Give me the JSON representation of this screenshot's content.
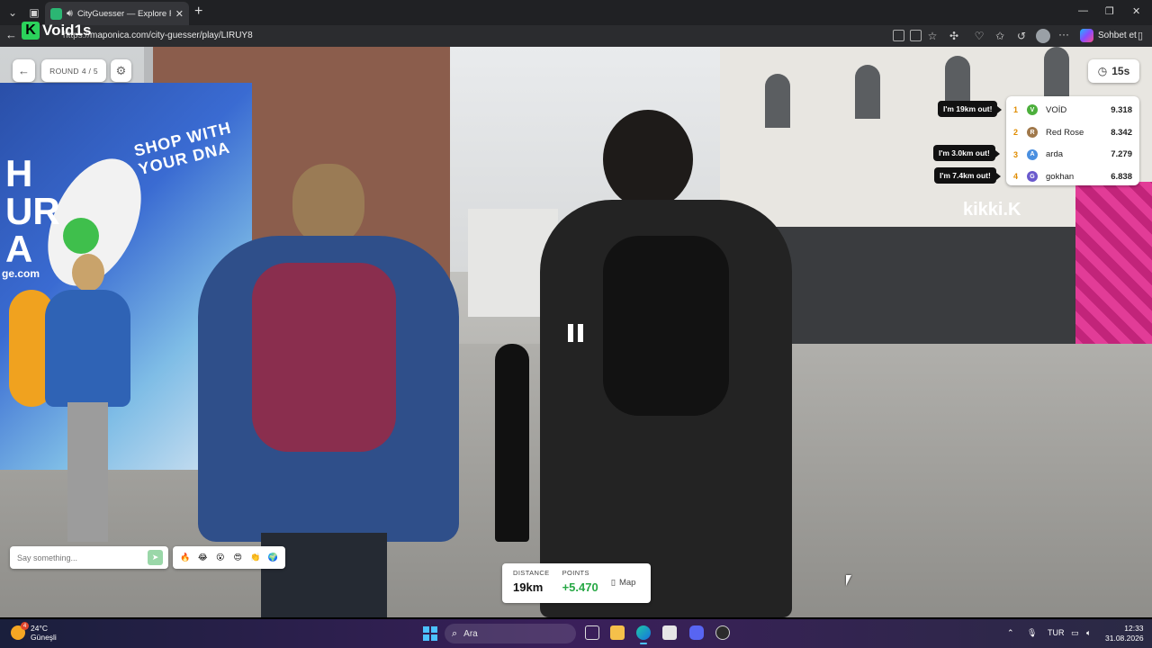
{
  "browser": {
    "tab_title": "CityGuesser — Explore Real C",
    "url_scheme": "https://",
    "url_rest": "maponica.com/city-guesser/play/LIRUY8",
    "profile_label": "Sohbet et"
  },
  "overlay_logo": {
    "letter": "K",
    "text": "Void1s"
  },
  "game": {
    "round_label": "ROUND",
    "round_value": "4 / 5",
    "timer": "15s",
    "leaderboard": [
      {
        "rank": "1",
        "avatar": "V",
        "name": "VOİD",
        "score": "9.318",
        "color": "#4caf3c"
      },
      {
        "rank": "2",
        "avatar": "R",
        "name": "Red Rose",
        "score": "8.342",
        "color": "#a0784a"
      },
      {
        "rank": "3",
        "avatar": "A",
        "name": "arda",
        "score": "7.279",
        "color": "#4a8fe0"
      },
      {
        "rank": "4",
        "avatar": "G",
        "name": "gokhan",
        "score": "6.838",
        "color": "#6a5acd"
      }
    ],
    "bubbles": [
      "I'm 19km out!",
      "I'm 3.0km out!",
      "I'm 7.4km out!"
    ],
    "chat_placeholder": "Say something...",
    "emojis": [
      "🔥",
      "😂",
      "😮",
      "😍",
      "👏",
      "🌍"
    ],
    "result": {
      "distance_label": "DISTANCE",
      "distance_value": "19km",
      "points_label": "POINTS",
      "points_value": "+5.470",
      "map_label": "Map"
    }
  },
  "scene": {
    "hoarding_slogan": "SHOP WITH YOUR DNA",
    "hoarding_letters": "H\nUR\nA",
    "hoarding_url": "ge.com",
    "shop_sign": "kikki.K"
  },
  "taskbar": {
    "temperature": "24°C",
    "weather": "Güneşli",
    "weather_badge": "4",
    "search_placeholder": "Ara",
    "language": "TUR",
    "time": "12:33",
    "date": "31.08.2026"
  }
}
